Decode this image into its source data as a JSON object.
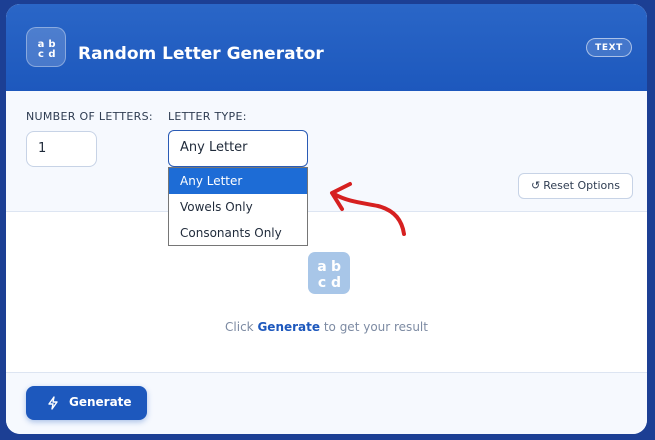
{
  "header": {
    "logo_icon": "abcd-letters-icon",
    "logo_letters": [
      "a",
      "b",
      "c",
      "d"
    ],
    "title": "Random Letter Generator",
    "badge": "TEXT"
  },
  "options": {
    "count_label": "NUMBER OF LETTERS:",
    "count_value": "1",
    "type_label": "LETTER TYPE:",
    "type_selected": "Any Letter",
    "type_options": [
      "Any Letter",
      "Vowels Only",
      "Consonants Only"
    ],
    "reset_icon": "reset-icon",
    "reset_label": "Reset Options"
  },
  "result": {
    "placeholder_icon": "abcd-letters-icon",
    "placeholder_letters": [
      "a",
      "b",
      "c",
      "d"
    ],
    "hint_prefix": "Click ",
    "hint_action": "Generate",
    "hint_suffix": " to get your result"
  },
  "footer": {
    "generate_icon": "lightning-icon",
    "generate_label": "Generate"
  },
  "annotation": {
    "arrow_icon": "hand-drawn-arrow-icon",
    "arrow_color": "#d62020"
  },
  "colors": {
    "page_bg": "#1c3f94",
    "header_bg": "#2a66c7",
    "accent": "#1d58bd",
    "selected_option": "#1d6cd6"
  }
}
